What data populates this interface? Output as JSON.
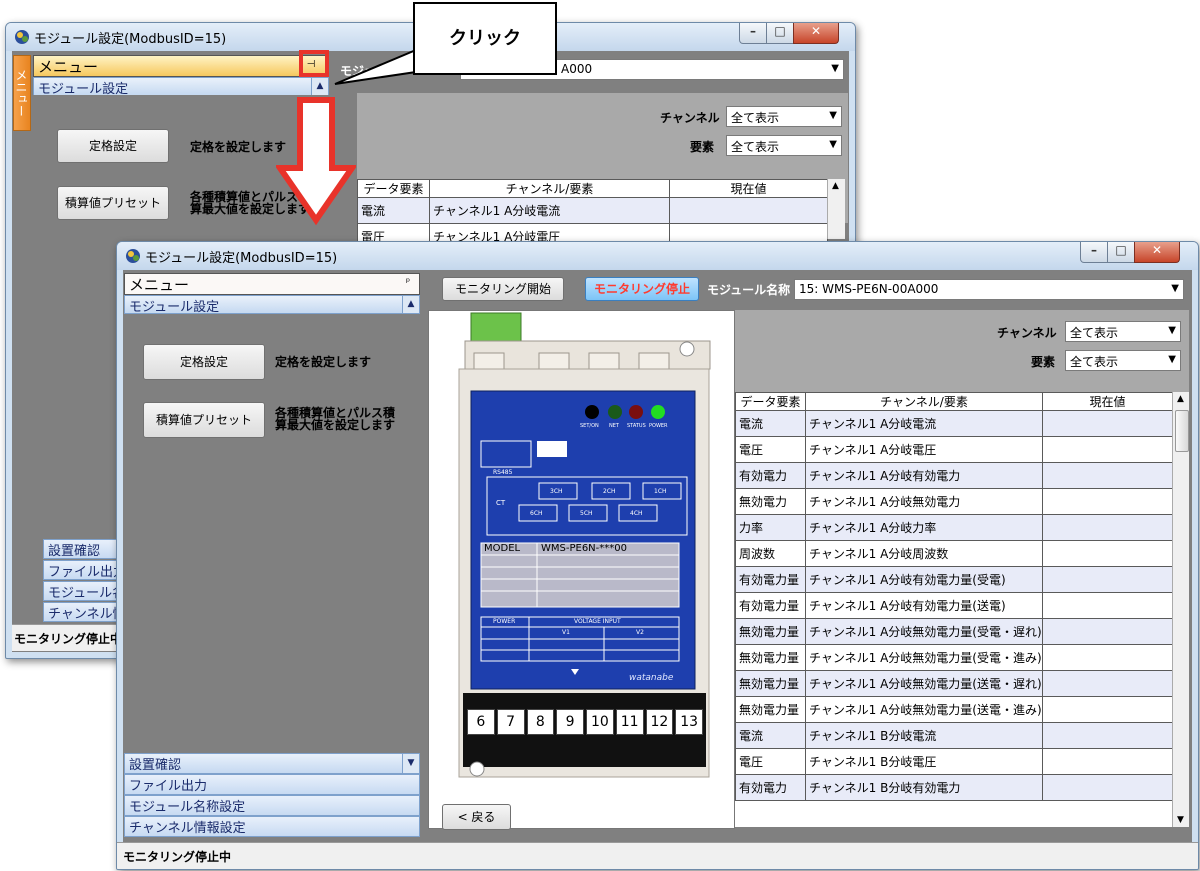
{
  "back_window": {
    "title": "モジュール設定(ModbusID=15)",
    "menu_label": "メニュー",
    "side_tab_label": "メニュー",
    "section_label": "モジュール設定",
    "pin_glyph": "⊣",
    "rated_button": "定格設定",
    "rated_desc": "定格を設定します",
    "preset_button": "積算値プリセット",
    "preset_desc_line1": "各種積算値とパルス積",
    "preset_desc_line2": "算最大値を設定します",
    "module_label": "モジュ",
    "module_value": "A000",
    "channel_label": "チャンネル",
    "channel_value": "全て表示",
    "element_label": "要素",
    "element_value": "全て表示",
    "table_headers": [
      "データ要素",
      "チャンネル/要素",
      "現在値"
    ],
    "rows": [
      {
        "elem": "電流",
        "chan": "チャンネル1 A分岐電流",
        "val": ""
      },
      {
        "elem": "電圧",
        "chan": "チャンネル1 A分岐電圧",
        "val": ""
      }
    ],
    "nav": [
      "設置確認",
      "ファイル出力",
      "モジュール名",
      "チャンネル情"
    ],
    "status": "モニタリング停止中"
  },
  "callout": {
    "text": "クリック"
  },
  "colors": {
    "highlight": "#e8332a",
    "arrow": "#e8332a",
    "accent": "#ff4a3a"
  },
  "front_window": {
    "title": "モジュール設定(ModbusID=15)",
    "menu_label": "メニュー",
    "pin_glyph": "ᵖ",
    "section_label": "モジュール設定",
    "rated_button": "定格設定",
    "rated_desc": "定格を設定します",
    "preset_button": "積算値プリセット",
    "preset_desc_line1": "各種積算値とパルス積",
    "preset_desc_line2": "算最大値を設定します",
    "nav": [
      "設置確認",
      "ファイル出力",
      "モジュール名称設定",
      "チャンネル情報設定"
    ],
    "toolbar": {
      "start_button": "モニタリング開始",
      "stop_button": "モニタリング停止",
      "module_name_label": "モジュール名称",
      "module_name_value": "15: WMS-PE6N-00A000"
    },
    "channel_label": "チャンネル",
    "channel_value": "全て表示",
    "element_label": "要素",
    "element_value": "全て表示",
    "table_headers": [
      "データ要素",
      "チャンネル/要素",
      "現在値"
    ],
    "rows": [
      {
        "elem": "電流",
        "chan": "チャンネル1 A分岐電流",
        "val": ""
      },
      {
        "elem": "電圧",
        "chan": "チャンネル1 A分岐電圧",
        "val": ""
      },
      {
        "elem": "有効電力",
        "chan": "チャンネル1 A分岐有効電力",
        "val": ""
      },
      {
        "elem": "無効電力",
        "chan": "チャンネル1 A分岐無効電力",
        "val": ""
      },
      {
        "elem": "力率",
        "chan": "チャンネル1 A分岐力率",
        "val": ""
      },
      {
        "elem": "周波数",
        "chan": "チャンネル1 A分岐周波数",
        "val": ""
      },
      {
        "elem": "有効電力量",
        "chan": "チャンネル1 A分岐有効電力量(受電)",
        "val": ""
      },
      {
        "elem": "有効電力量",
        "chan": "チャンネル1 A分岐有効電力量(送電)",
        "val": ""
      },
      {
        "elem": "無効電力量",
        "chan": "チャンネル1 A分岐無効電力量(受電・遅れ)",
        "val": ""
      },
      {
        "elem": "無効電力量",
        "chan": "チャンネル1 A分岐無効電力量(受電・進み)",
        "val": ""
      },
      {
        "elem": "無効電力量",
        "chan": "チャンネル1 A分岐無効電力量(送電・遅れ)",
        "val": ""
      },
      {
        "elem": "無効電力量",
        "chan": "チャンネル1 A分岐無効電力量(送電・進み)",
        "val": ""
      },
      {
        "elem": "電流",
        "chan": "チャンネル1 B分岐電流",
        "val": ""
      },
      {
        "elem": "電圧",
        "chan": "チャンネル1 B分岐電圧",
        "val": ""
      },
      {
        "elem": "有効電力",
        "chan": "チャンネル1 B分岐有効電力",
        "val": ""
      }
    ],
    "back_button": "< 戻る",
    "status": "モニタリング停止中",
    "device": {
      "model_label": "MODEL",
      "model_value": "WMS-PE6N-***00",
      "led_labels": [
        "SET/ON",
        "NET",
        "STATUS",
        "POWER"
      ],
      "rs485_label": "RS485",
      "ct_label": "CT",
      "ch_labels": [
        "3CH",
        "2CH",
        "1CH",
        "6CH",
        "5CH",
        "4CH"
      ],
      "power_label": "POWER",
      "voltage_label": "VOLTAGE INPUT",
      "v1_label": "V1",
      "v2_label": "V2",
      "brand": "watanabe",
      "terminals": [
        "6",
        "7",
        "8",
        "9",
        "10",
        "11",
        "12",
        "13"
      ]
    }
  }
}
